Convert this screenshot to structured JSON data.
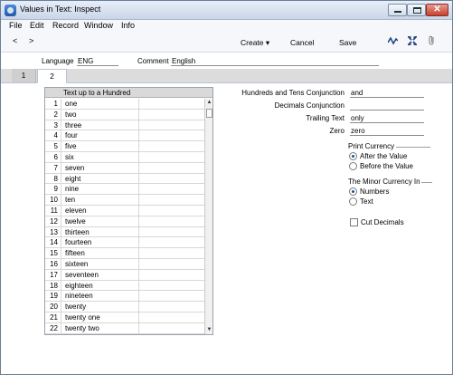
{
  "window": {
    "title": "Values in Text: Inspect"
  },
  "menu": [
    "File",
    "Edit",
    "Record",
    "Window",
    "Info"
  ],
  "toolbar": {
    "prev": "<",
    "next": ">",
    "create": "Create",
    "cancel": "Cancel",
    "save": "Save"
  },
  "header": {
    "language_label": "Language",
    "language_value": "ENG",
    "comment_label": "Comment",
    "comment_value": "English"
  },
  "tabs": [
    {
      "label": "1",
      "selected": false
    },
    {
      "label": "2",
      "selected": true
    }
  ],
  "table": {
    "column_header": "Text up to a Hundred",
    "rows": [
      {
        "n": "1",
        "text": "one"
      },
      {
        "n": "2",
        "text": "two"
      },
      {
        "n": "3",
        "text": "three"
      },
      {
        "n": "4",
        "text": "four"
      },
      {
        "n": "5",
        "text": "five"
      },
      {
        "n": "6",
        "text": "six"
      },
      {
        "n": "7",
        "text": "seven"
      },
      {
        "n": "8",
        "text": "eight"
      },
      {
        "n": "9",
        "text": "nine"
      },
      {
        "n": "10",
        "text": "ten"
      },
      {
        "n": "11",
        "text": "eleven"
      },
      {
        "n": "12",
        "text": "twelve"
      },
      {
        "n": "13",
        "text": "thirteen"
      },
      {
        "n": "14",
        "text": "fourteen"
      },
      {
        "n": "15",
        "text": "fifteen"
      },
      {
        "n": "16",
        "text": "sixteen"
      },
      {
        "n": "17",
        "text": "seventeen"
      },
      {
        "n": "18",
        "text": "eighteen"
      },
      {
        "n": "19",
        "text": "nineteen"
      },
      {
        "n": "20",
        "text": "twenty"
      },
      {
        "n": "21",
        "text": "twenty one"
      },
      {
        "n": "22",
        "text": "twenty two"
      }
    ]
  },
  "fields": {
    "hundreds_conj_label": "Hundreds and Tens Conjunction",
    "hundreds_conj_value": "and",
    "decimals_conj_label": "Decimals Conjunction",
    "decimals_conj_value": "",
    "trailing_label": "Trailing Text",
    "trailing_value": "only",
    "zero_label": "Zero",
    "zero_value": "zero"
  },
  "print_currency": {
    "label": "Print Currency",
    "options": [
      "After the Value",
      "Before the Value"
    ],
    "selected": "After the Value"
  },
  "minor_currency": {
    "label": "The Minor Currency In",
    "options": [
      "Numbers",
      "Text"
    ],
    "selected": "Numbers"
  },
  "cut_decimals": {
    "label": "Cut Decimals",
    "checked": false
  },
  "colors": {
    "accent": "#1b4e9a",
    "titlebar": "#c9d6e8",
    "close": "#c6412f"
  }
}
